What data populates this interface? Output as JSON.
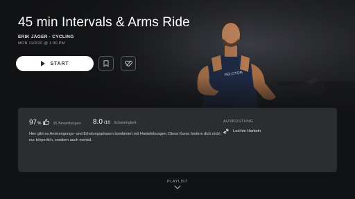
{
  "class": {
    "title": "45 min Intervals & Arms Ride",
    "instructor": "ERIK JÄGER",
    "separator": "·",
    "discipline": "CYCLING",
    "date": "MON 11/9/20 @ 1:30 PM"
  },
  "actions": {
    "start_label": "START",
    "bookmark_icon": "bookmark-icon",
    "favorite_icon": "heart-icon"
  },
  "stats": {
    "rating_percent": "97",
    "rating_unit": "%",
    "rating_count_label": "35 Bewertungen",
    "difficulty_value": "8.0",
    "difficulty_scale": "/10",
    "difficulty_label": "Schwierigkeit"
  },
  "description": "Hier gibt es Anstrengungs- und Erholungsphasen kombiniert mit Hantelübungen. Diese Kurse fordern dich nicht nur körperlich, sondern auch mental.",
  "equipment": {
    "heading": "AUSRÜSTUNG",
    "items": [
      {
        "label": "Leichte Hanteln",
        "icon": "dumbbell-icon"
      }
    ]
  },
  "footer": {
    "playlist_label": "PLAYLIST",
    "icon": "chevron-down-icon"
  },
  "colors": {
    "background": "#111214",
    "panel": "#2c2d31",
    "button": "#ffffff",
    "muted_text": "#a4a6ac"
  }
}
